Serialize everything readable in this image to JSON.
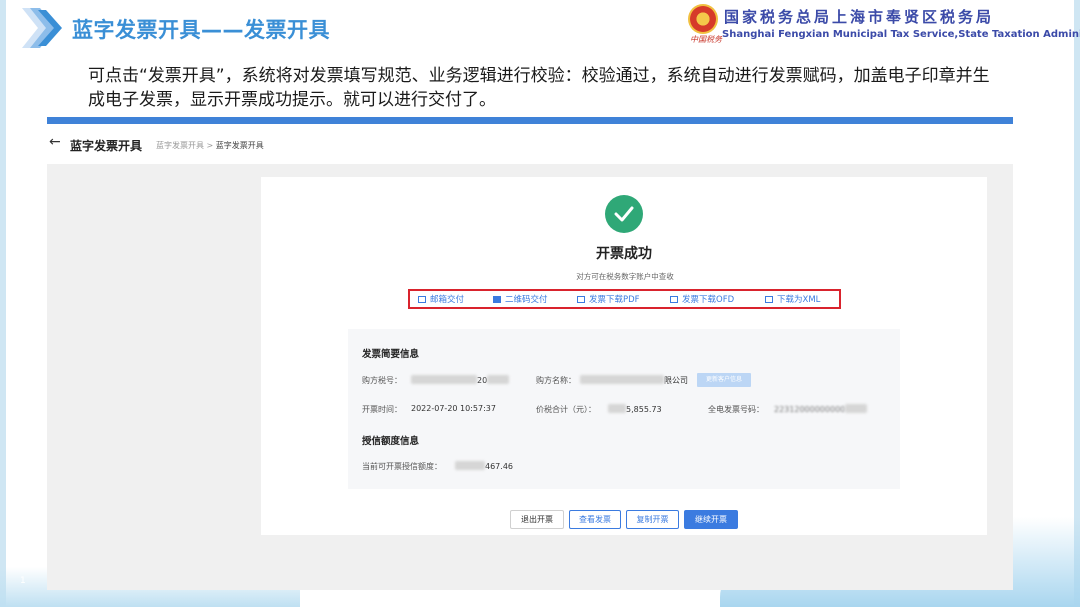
{
  "slide": {
    "title": "蓝字发票开具——发票开具",
    "description": "可点击“发票开具”，系统将对发票填写规范、业务逻辑进行校验：校验通过，系统自动进行发票赋码，加盖电子印章并生成电子发票，显示开票成功提示。就可以进行交付了。",
    "org_cn": "国家税务总局上海市奉贤区税务局",
    "org_en": "Shanghai Fengxian Municipal Tax Service,State Taxation Administration",
    "signature": "中国税务",
    "page_number": "1"
  },
  "app": {
    "back_icon": "arrow-left-icon",
    "title": "蓝字发票开具",
    "breadcrumb": {
      "parent": "蓝字发票开具",
      "separator": ">",
      "current": "蓝字发票开具"
    }
  },
  "result": {
    "status_icon": "check-circle-icon",
    "title": "开票成功",
    "note": "对方可在税务数字账户中查收",
    "actions": [
      {
        "label": "邮箱交付",
        "icon": "mail-icon"
      },
      {
        "label": "二维码交付",
        "icon": "qrcode-icon"
      },
      {
        "label": "发票下载PDF",
        "icon": "file-pdf-icon"
      },
      {
        "label": "发票下载OFD",
        "icon": "file-ofd-icon"
      },
      {
        "label": "下载为XML",
        "icon": "file-xml-icon"
      }
    ]
  },
  "summary": {
    "title": "发票简要信息",
    "buyer_tax_label": "购方税号：",
    "buyer_tax_value_suffix": "20",
    "buyer_name_label": "购方名称：",
    "buyer_name_value_suffix": "限公司",
    "update_button": "更新客户信息",
    "issue_time_label": "开票时间：",
    "issue_time_value": "2022-07-20 10:57:37",
    "total_label": "价税合计（元）：",
    "total_value_suffix": "5,855.73",
    "invoice_no_label": "全电发票号码：",
    "invoice_no_value_prefix": "22312000000000"
  },
  "credit": {
    "title": "授信额度信息",
    "current_label": "当前可开票授信额度：",
    "current_value_suffix": "467.46"
  },
  "footer_buttons": {
    "exit": "退出开票",
    "view": "查看发票",
    "copy": "复制开票",
    "continue": "继续开票"
  },
  "colors": {
    "accent": "#3b7be0",
    "title_blue": "#3a8fd6",
    "success_green": "#2fa877",
    "highlight_red": "#d9232d",
    "divider_blue": "#3f82d8"
  }
}
